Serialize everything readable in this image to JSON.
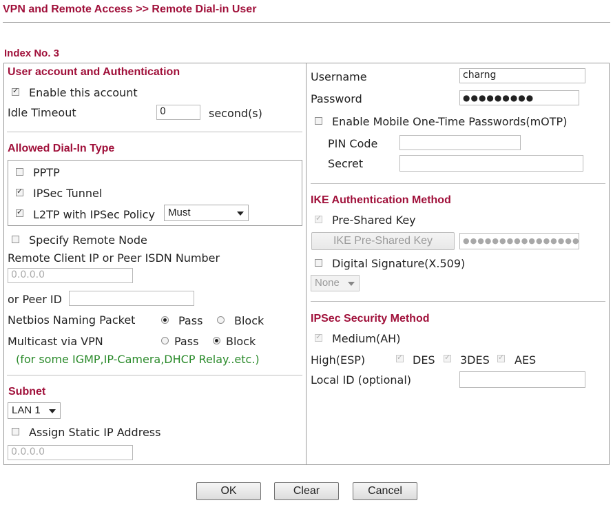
{
  "page_title": "VPN and Remote Access >> Remote Dial-in User",
  "index_label": "Index No. 3",
  "left": {
    "account_section": "User account and Authentication",
    "enable_account_label": "Enable this account",
    "idle_timeout_label": "Idle Timeout",
    "idle_timeout_value": "0",
    "idle_timeout_unit": "second(s)",
    "dialin_section": "Allowed Dial-In Type",
    "pptp_label": "PPTP",
    "ipsec_tunnel_label": "IPSec Tunnel",
    "l2tp_label": "L2TP with IPSec Policy",
    "l2tp_policy_value": "Must",
    "remote_node_label": "Specify Remote Node",
    "remote_ip_label": "Remote Client IP or Peer ISDN Number",
    "remote_ip_placeholder": "0.0.0.0",
    "peer_id_label": "or Peer ID",
    "peer_id_value": "",
    "netbios_label": "Netbios Naming Packet",
    "netbios_pass": "Pass",
    "netbios_block": "Block",
    "multicast_label": "Multicast via VPN",
    "multicast_pass": "Pass",
    "multicast_block": "Block",
    "multicast_note": "(for some IGMP,IP-Camera,DHCP Relay..etc.)",
    "subnet_section": "Subnet",
    "subnet_value": "LAN 1",
    "static_ip_label": "Assign Static IP Address",
    "static_ip_placeholder": "0.0.0.0"
  },
  "right": {
    "username_label": "Username",
    "username_value": "charng",
    "password_label": "Password",
    "password_value": "●●●●●●●●●",
    "motp_label": "Enable Mobile One-Time Passwords(mOTP)",
    "pin_label": "PIN Code",
    "secret_label": "Secret",
    "ike_section": "IKE Authentication Method",
    "psk_label": "Pre-Shared Key",
    "psk_button": "IKE Pre-Shared Key",
    "psk_value": "●●●●●●●●●●●●●●●●",
    "digsig_label": "Digital Signature(X.509)",
    "digsig_value": "None",
    "ipsec_section": "IPSec Security Method",
    "medium_label": "Medium(AH)",
    "high_label": "High(ESP)",
    "des_label": "DES",
    "tdes_label": "3DES",
    "aes_label": "AES",
    "local_id_label": "Local ID (optional)",
    "local_id_value": ""
  },
  "buttons": {
    "ok": "OK",
    "clear": "Clear",
    "cancel": "Cancel"
  },
  "colors": {
    "heading": "#a0103a",
    "note_green": "#2a8a2a"
  }
}
